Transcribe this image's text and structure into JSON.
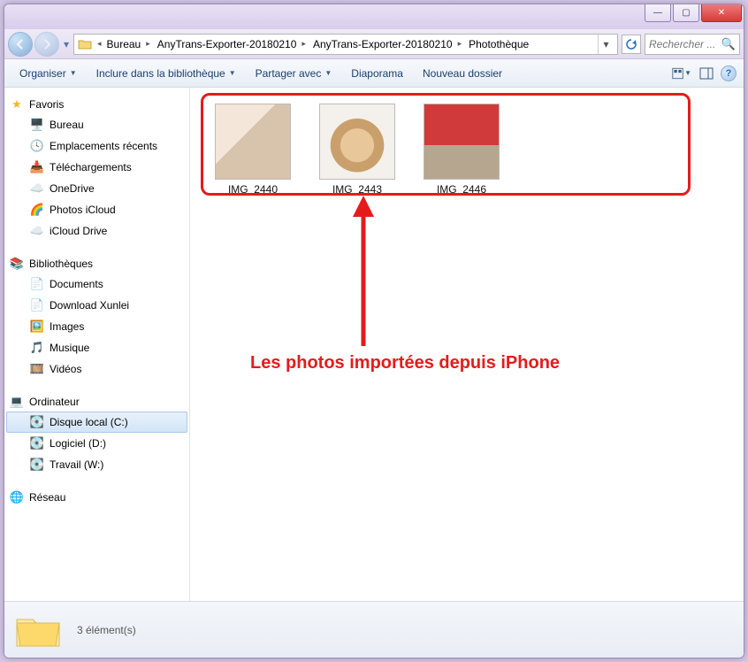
{
  "window_controls": {
    "min": "—",
    "max": "▢",
    "close": "✕"
  },
  "breadcrumbs": [
    "Bureau",
    "AnyTrans-Exporter-20180210",
    "AnyTrans-Exporter-20180210",
    "Photothèque"
  ],
  "search": {
    "placeholder": "Rechercher ..."
  },
  "toolbar": {
    "organiser": "Organiser",
    "biblio": "Inclure dans la bibliothèque",
    "partager": "Partager avec",
    "diaporama": "Diaporama",
    "nouveau": "Nouveau dossier"
  },
  "nav": {
    "favoris": {
      "title": "Favoris",
      "items": [
        "Bureau",
        "Emplacements récents",
        "Téléchargements",
        "OneDrive",
        "Photos iCloud",
        "iCloud Drive"
      ]
    },
    "biblio": {
      "title": "Bibliothèques",
      "items": [
        "Documents",
        "Download Xunlei",
        "Images",
        "Musique",
        "Vidéos"
      ]
    },
    "ordi": {
      "title": "Ordinateur",
      "items": [
        "Disque local (C:)",
        "Logiciel (D:)",
        "Travail (W:)"
      ]
    },
    "reseau": {
      "title": "Réseau"
    }
  },
  "files": [
    {
      "name": "IMG_2440"
    },
    {
      "name": "IMG_2443"
    },
    {
      "name": "IMG_2446"
    }
  ],
  "annotation": "Les photos importées depuis iPhone",
  "status": "3 élément(s)"
}
